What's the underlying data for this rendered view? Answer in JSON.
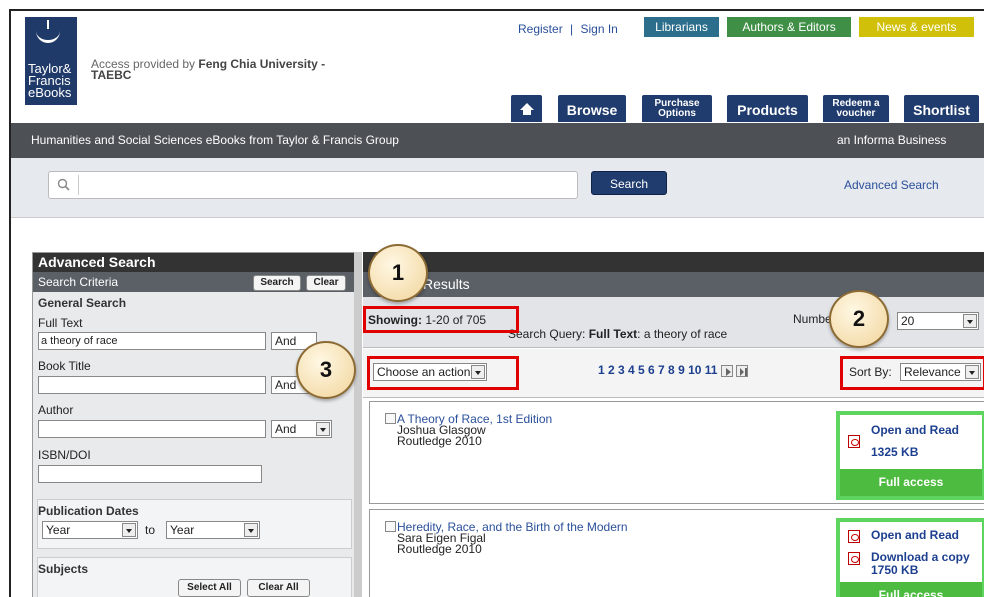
{
  "header": {
    "logo_lines": [
      "Taylor&",
      "Francis",
      "eBooks"
    ],
    "access_prefix": "Access provided by ",
    "access_org": "Feng Chia University -",
    "access_org2": "TAEBC",
    "register": "Register",
    "separator": "|",
    "sign_in": "Sign In",
    "top_tabs": [
      {
        "label": "Librarians",
        "color": "#2c6e8c"
      },
      {
        "label": "Authors & Editors",
        "color": "#3f8f46"
      },
      {
        "label": "News & events",
        "color": "#d1c00a"
      }
    ],
    "nav": {
      "home_icon": "home-icon",
      "browse": "Browse",
      "purchase_1": "Purchase",
      "purchase_2": "Options",
      "products": "Products",
      "redeem_1": "Redeem a",
      "redeem_2": "voucher",
      "shortlist": "Shortlist"
    }
  },
  "banner": {
    "left": "Humanities and Social Sciences eBooks from Taylor & Francis Group",
    "right": "an Informa Business"
  },
  "search": {
    "value": "",
    "button": "Search",
    "advanced_link": "Advanced Search"
  },
  "advanced": {
    "title": "Advanced Search",
    "criteria": "Search Criteria",
    "search_btn": "Search",
    "clear_btn": "Clear",
    "general": "General Search",
    "full_text_label": "Full Text",
    "full_text_value": "a theory of race",
    "op1": "And",
    "book_title_label": "Book Title",
    "book_title_value": "",
    "op2": "And",
    "author_label": "Author",
    "author_value": "",
    "op3": "And",
    "isbn_label": "ISBN/DOI",
    "isbn_value": "",
    "pubdates": "Publication Dates",
    "year_from": "Year",
    "to": "to",
    "year_to": "Year",
    "subjects": "Subjects",
    "select_all": "Select All",
    "clear_all": "Clear All"
  },
  "results": {
    "header_suffix": "Results",
    "showing_label": "Showing:",
    "showing_value": "1-20 of 705",
    "query_prefix": "Search Query:",
    "query_field": "Full Text",
    "query_value": ": a theory of race",
    "number_label": "Numbe",
    "per_page": "20",
    "action": "Choose an action",
    "pages": "1 2 3 4 5 6 7 8 9 10 11",
    "sort_label": "Sort By:",
    "sort_value": "Relevance",
    "items": [
      {
        "title": "A Theory of Race, 1st Edition",
        "author": "Joshua Glasgow",
        "publisher": "Routledge 2010",
        "open": "Open and Read",
        "size": "1325 KB",
        "access": "Full access"
      },
      {
        "title": "Heredity, Race, and the Birth of the Modern",
        "author": "Sara Eigen Figal",
        "publisher": "Routledge 2010",
        "open": "Open and Read",
        "download": "Download a copy",
        "size": "1750 KB",
        "access": "Full access"
      }
    ]
  },
  "callouts": [
    "1",
    "2",
    "3"
  ]
}
